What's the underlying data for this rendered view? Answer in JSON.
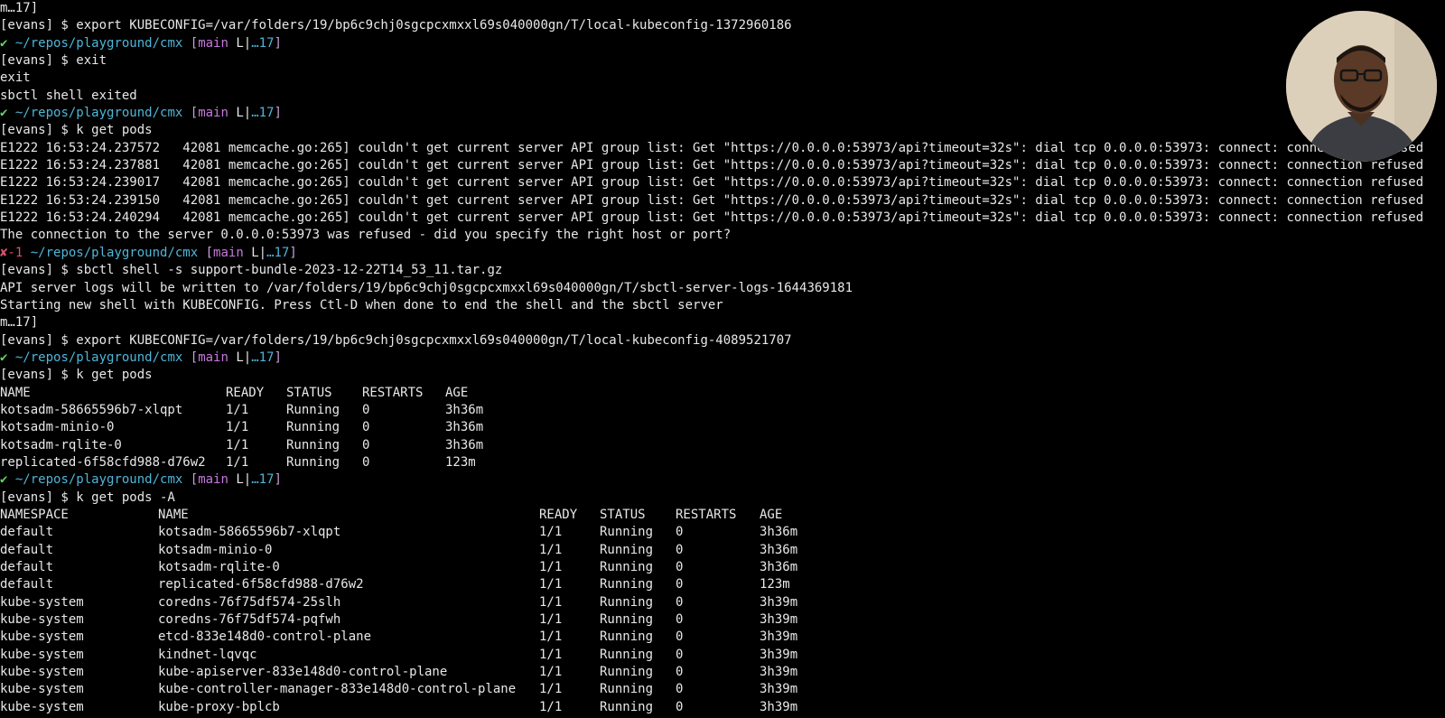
{
  "terminal": {
    "lines": [
      {
        "type": "plain",
        "text": "m…17]"
      },
      {
        "type": "plain",
        "text": "[evans] $ export KUBECONFIG=/var/folders/19/bp6c9chj0sgcpcxmxxl69s040000gn/T/local-kubeconfig-1372960186"
      },
      {
        "type": "prompt",
        "status": "✔",
        "status_kind": "ok",
        "path": "~/repos/playground/cmx",
        "branch": "main",
        "git_mid": "L|",
        "git_count": "…17"
      },
      {
        "type": "plain",
        "text": "[evans] $ exit"
      },
      {
        "type": "plain",
        "text": "exit"
      },
      {
        "type": "plain",
        "text": "sbctl shell exited"
      },
      {
        "type": "prompt",
        "status": "✔",
        "status_kind": "ok",
        "path": "~/repos/playground/cmx",
        "branch": "main",
        "git_mid": "L|",
        "git_count": "…17"
      },
      {
        "type": "plain",
        "text": "[evans] $ k get pods"
      },
      {
        "type": "plain",
        "text": "E1222 16:53:24.237572   42081 memcache.go:265] couldn't get current server API group list: Get \"https://0.0.0.0:53973/api?timeout=32s\": dial tcp 0.0.0.0:53973: connect: connection refused"
      },
      {
        "type": "plain",
        "text": "E1222 16:53:24.237881   42081 memcache.go:265] couldn't get current server API group list: Get \"https://0.0.0.0:53973/api?timeout=32s\": dial tcp 0.0.0.0:53973: connect: connection refused"
      },
      {
        "type": "plain",
        "text": "E1222 16:53:24.239017   42081 memcache.go:265] couldn't get current server API group list: Get \"https://0.0.0.0:53973/api?timeout=32s\": dial tcp 0.0.0.0:53973: connect: connection refused"
      },
      {
        "type": "plain",
        "text": "E1222 16:53:24.239150   42081 memcache.go:265] couldn't get current server API group list: Get \"https://0.0.0.0:53973/api?timeout=32s\": dial tcp 0.0.0.0:53973: connect: connection refused"
      },
      {
        "type": "plain",
        "text": "E1222 16:53:24.240294   42081 memcache.go:265] couldn't get current server API group list: Get \"https://0.0.0.0:53973/api?timeout=32s\": dial tcp 0.0.0.0:53973: connect: connection refused"
      },
      {
        "type": "plain",
        "text": "The connection to the server 0.0.0.0:53973 was refused - did you specify the right host or port?"
      },
      {
        "type": "prompt",
        "status": "✘-1",
        "status_kind": "fail",
        "path": "~/repos/playground/cmx",
        "branch": "main",
        "git_mid": "L|",
        "git_count": "…17"
      },
      {
        "type": "plain",
        "text": "[evans] $ sbctl shell -s support-bundle-2023-12-22T14_53_11.tar.gz"
      },
      {
        "type": "plain",
        "text": "API server logs will be written to /var/folders/19/bp6c9chj0sgcpcxmxxl69s040000gn/T/sbctl-server-logs-1644369181"
      },
      {
        "type": "plain",
        "text": "Starting new shell with KUBECONFIG. Press Ctl-D when done to end the shell and the sbctl server"
      },
      {
        "type": "plain",
        "text": "m…17]"
      },
      {
        "type": "plain",
        "text": "[evans] $ export KUBECONFIG=/var/folders/19/bp6c9chj0sgcpcxmxxl69s040000gn/T/local-kubeconfig-4089521707"
      },
      {
        "type": "prompt",
        "status": "✔",
        "status_kind": "ok",
        "path": "~/repos/playground/cmx",
        "branch": "main",
        "git_mid": "L|",
        "git_count": "…17"
      },
      {
        "type": "plain",
        "text": "[evans] $ k get pods"
      },
      {
        "type": "table5",
        "cells": [
          "NAME",
          "READY",
          "STATUS",
          "RESTARTS",
          "AGE"
        ]
      },
      {
        "type": "table5",
        "cells": [
          "kotsadm-58665596b7-xlqpt",
          "1/1",
          "Running",
          "0",
          "3h36m"
        ]
      },
      {
        "type": "table5",
        "cells": [
          "kotsadm-minio-0",
          "1/1",
          "Running",
          "0",
          "3h36m"
        ]
      },
      {
        "type": "table5",
        "cells": [
          "kotsadm-rqlite-0",
          "1/1",
          "Running",
          "0",
          "3h36m"
        ]
      },
      {
        "type": "table5",
        "cells": [
          "replicated-6f58cfd988-d76w2",
          "1/1",
          "Running",
          "0",
          "123m"
        ]
      },
      {
        "type": "prompt",
        "status": "✔",
        "status_kind": "ok",
        "path": "~/repos/playground/cmx",
        "branch": "main",
        "git_mid": "L|",
        "git_count": "…17"
      },
      {
        "type": "plain",
        "text": "[evans] $ k get pods -A"
      },
      {
        "type": "table6",
        "cells": [
          "NAMESPACE",
          "NAME",
          "READY",
          "STATUS",
          "RESTARTS",
          "AGE"
        ]
      },
      {
        "type": "table6",
        "cells": [
          "default",
          "kotsadm-58665596b7-xlqpt",
          "1/1",
          "Running",
          "0",
          "3h36m"
        ]
      },
      {
        "type": "table6",
        "cells": [
          "default",
          "kotsadm-minio-0",
          "1/1",
          "Running",
          "0",
          "3h36m"
        ]
      },
      {
        "type": "table6",
        "cells": [
          "default",
          "kotsadm-rqlite-0",
          "1/1",
          "Running",
          "0",
          "3h36m"
        ]
      },
      {
        "type": "table6",
        "cells": [
          "default",
          "replicated-6f58cfd988-d76w2",
          "1/1",
          "Running",
          "0",
          "123m"
        ]
      },
      {
        "type": "table6",
        "cells": [
          "kube-system",
          "coredns-76f75df574-25slh",
          "1/1",
          "Running",
          "0",
          "3h39m"
        ]
      },
      {
        "type": "table6",
        "cells": [
          "kube-system",
          "coredns-76f75df574-pqfwh",
          "1/1",
          "Running",
          "0",
          "3h39m"
        ]
      },
      {
        "type": "table6",
        "cells": [
          "kube-system",
          "etcd-833e148d0-control-plane",
          "1/1",
          "Running",
          "0",
          "3h39m"
        ]
      },
      {
        "type": "table6",
        "cells": [
          "kube-system",
          "kindnet-lqvqc",
          "1/1",
          "Running",
          "0",
          "3h39m"
        ]
      },
      {
        "type": "table6",
        "cells": [
          "kube-system",
          "kube-apiserver-833e148d0-control-plane",
          "1/1",
          "Running",
          "0",
          "3h39m"
        ]
      },
      {
        "type": "table6",
        "cells": [
          "kube-system",
          "kube-controller-manager-833e148d0-control-plane",
          "1/1",
          "Running",
          "0",
          "3h39m"
        ]
      },
      {
        "type": "table6",
        "cells": [
          "kube-system",
          "kube-proxy-bplcb",
          "1/1",
          "Running",
          "0",
          "3h39m"
        ]
      }
    ]
  },
  "colors": {
    "background": "#000000",
    "text": "#e8e8e8",
    "ok": "#5fd75f",
    "fail": "#e0506a",
    "path": "#4fb5d9",
    "branch": "#c678dd"
  },
  "webcam": {
    "icon": "presenter-webcam-feed"
  }
}
